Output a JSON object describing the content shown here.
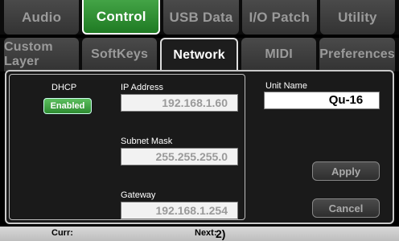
{
  "tabs_top": [
    {
      "label": "Audio",
      "state": "inactive"
    },
    {
      "label": "Control",
      "state": "active"
    },
    {
      "label": "USB Data",
      "state": "inactive"
    },
    {
      "label": "I/O Patch",
      "state": "inactive"
    },
    {
      "label": "Utility",
      "state": "inactive"
    }
  ],
  "tabs_sub": [
    {
      "label": "Custom Layer",
      "state": "inactive"
    },
    {
      "label": "SoftKeys",
      "state": "inactive"
    },
    {
      "label": "Network",
      "state": "active"
    },
    {
      "label": "MIDI",
      "state": "inactive"
    },
    {
      "label": "Preferences",
      "state": "inactive"
    }
  ],
  "network": {
    "dhcp_label": "DHCP",
    "dhcp_value": "Enabled",
    "ip_label": "IP Address",
    "ip_value": "192.168.1.60",
    "subnet_label": "Subnet Mask",
    "subnet_value": "255.255.255.0",
    "gateway_label": "Gateway",
    "gateway_value": "192.168.1.254"
  },
  "unit": {
    "name_label": "Unit Name",
    "name_value": "Qu-16"
  },
  "buttons": {
    "apply": "Apply",
    "cancel": "Cancel"
  },
  "status": {
    "curr_label": "Curr:",
    "next_label": "Next:",
    "next_value": "2)"
  },
  "colors": {
    "active_green": "#2e8c31",
    "panel_bg": "#1a1a1a"
  }
}
